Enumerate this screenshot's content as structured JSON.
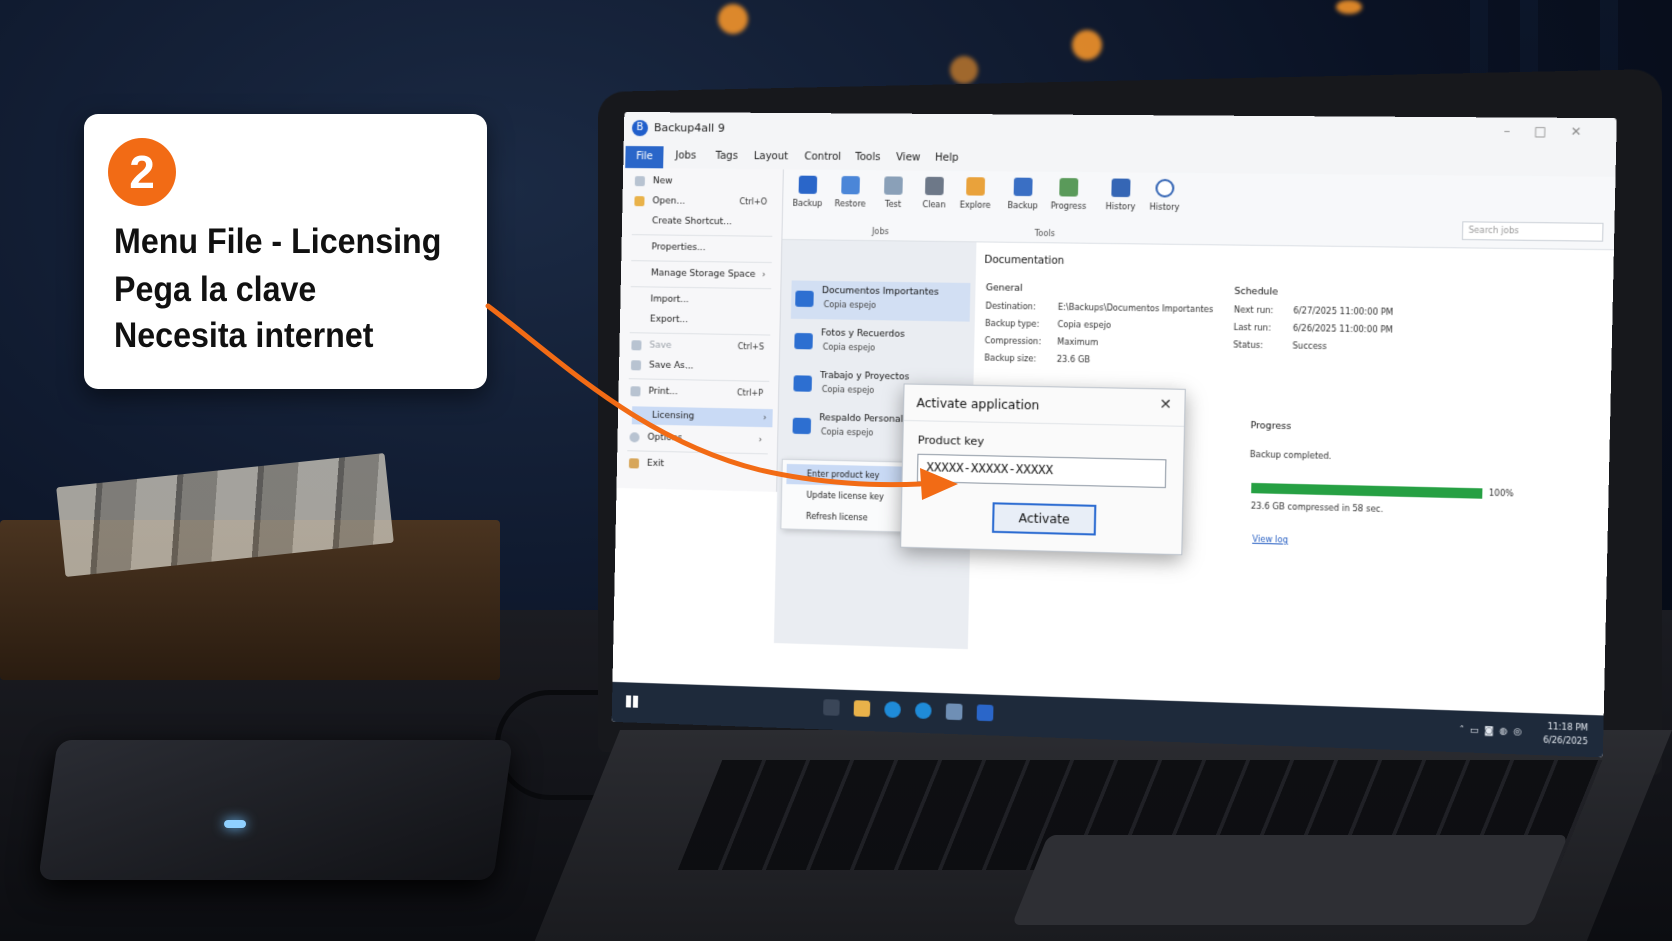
{
  "callout": {
    "step": "2",
    "line1": "Menu File - Licensing",
    "line2": "Pega la clave",
    "line3": "Necesita internet"
  },
  "app": {
    "title": "Backup4all 9",
    "menus": [
      "File",
      "Jobs",
      "Tags",
      "Layout",
      "Control",
      "Tools",
      "View",
      "Help"
    ]
  },
  "ribbon": {
    "buttons": [
      "Backup",
      "Restore",
      "Test",
      "Clean",
      "Explore",
      "Backup",
      "Progress",
      "History",
      "History"
    ],
    "groups": [
      "Jobs",
      "Tools"
    ],
    "search_placeholder": "Search jobs"
  },
  "file_menu": {
    "items": [
      {
        "label": "New",
        "shortcut": ""
      },
      {
        "label": "Open...",
        "shortcut": "Ctrl+O"
      },
      {
        "label": "Create Shortcut...",
        "shortcut": ""
      },
      {
        "label": "Properties...",
        "shortcut": ""
      },
      {
        "label": "Manage Storage Space",
        "shortcut": "›"
      },
      {
        "label": "Import...",
        "shortcut": ""
      },
      {
        "label": "Export...",
        "shortcut": ""
      },
      {
        "label": "Save",
        "shortcut": "Ctrl+S"
      },
      {
        "label": "Save As...",
        "shortcut": ""
      },
      {
        "label": "Print...",
        "shortcut": "Ctrl+P"
      },
      {
        "label": "Licensing",
        "shortcut": "›"
      },
      {
        "label": "Options",
        "shortcut": "›"
      },
      {
        "label": "Exit",
        "shortcut": ""
      }
    ]
  },
  "licensing_submenu": [
    "Enter product key",
    "Update license key",
    "Refresh license"
  ],
  "jobs": [
    {
      "name": "Documentos Importantes",
      "type": "Copia espejo"
    },
    {
      "name": "Fotos y Recuerdos",
      "type": "Copia espejo"
    },
    {
      "name": "Trabajo y Proyectos",
      "type": "Copia espejo"
    },
    {
      "name": "Respaldo Personal",
      "type": "Copia espejo"
    }
  ],
  "details": {
    "title": "Documentation",
    "general_heading": "General",
    "general": [
      {
        "label": "Destination:",
        "value": "E:\\Backups\\Documentos Importantes"
      },
      {
        "label": "Backup type:",
        "value": "Copia espejo"
      },
      {
        "label": "Compression:",
        "value": "Maximum"
      },
      {
        "label": "Backup size:",
        "value": "23.6 GB"
      }
    ],
    "schedule_heading": "Schedule",
    "schedule": [
      {
        "label": "Next run:",
        "value": "6/27/2025 11:00:00 PM"
      },
      {
        "label": "Last run:",
        "value": "6/26/2025 11:00:00 PM"
      },
      {
        "label": "Status:",
        "value": "Success"
      }
    ],
    "progress_heading": "Progress",
    "progress_status": "Backup completed.",
    "progress_value": 1.0,
    "progress_pct": "100%",
    "progress_summary": "23.6 GB compressed in 58 sec.",
    "view_log": "View log"
  },
  "dialog": {
    "title": "Activate application",
    "close": "✕",
    "field_label": "Product key",
    "field_value": "XXXXX-XXXXX-XXXXX",
    "button": "Activate"
  },
  "taskbar": {
    "time": "11:18 PM",
    "date": "6/26/2025"
  },
  "colors": {
    "accent": "#2a66c9",
    "badge": "#f26b15",
    "progress": "#26a043"
  }
}
